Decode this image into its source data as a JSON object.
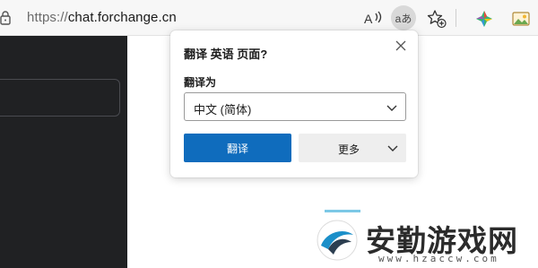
{
  "address_bar": {
    "url_protocol": "https://",
    "url_host": "chat.forchange.cn"
  },
  "toolbar": {
    "read_aloud_icon": "read-aloud-icon",
    "translate_icon": "translate-icon",
    "translate_glyph": "aあ",
    "favorites_icon": "add-favorite-icon",
    "extension_icon": "extension-icon",
    "image_icon": "image-icon"
  },
  "translate_popup": {
    "title": "翻译 英语 页面?",
    "translate_to_label": "翻译为",
    "selected_language": "中文 (简体)",
    "translate_button": "翻译",
    "more_button": "更多"
  },
  "watermark": {
    "name": "安勤游戏网",
    "url": "www.hzaccw.com"
  }
}
